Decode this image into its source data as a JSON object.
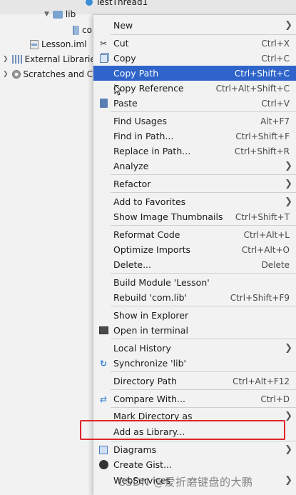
{
  "tree": {
    "top_item": "TestThread1",
    "lib_folder": "lib",
    "lib_child": "co",
    "lesson_iml": "Lesson.iml",
    "external_libraries": "External Librarie",
    "scratches": "Scratches and Co"
  },
  "menu": {
    "items": [
      {
        "label": "New",
        "shortcut": "",
        "submenu": true,
        "icon": ""
      },
      {
        "label": "Cut",
        "shortcut": "Ctrl+X",
        "submenu": false,
        "icon": "scissors-icon"
      },
      {
        "label": "Copy",
        "shortcut": "Ctrl+C",
        "submenu": false,
        "icon": "copy-icon"
      },
      {
        "label": "Copy Path",
        "shortcut": "Ctrl+Shift+C",
        "submenu": false,
        "icon": "",
        "highlighted": true
      },
      {
        "label": "Copy Reference",
        "shortcut": "Ctrl+Alt+Shift+C",
        "submenu": false,
        "icon": ""
      },
      {
        "label": "Paste",
        "shortcut": "Ctrl+V",
        "submenu": false,
        "icon": "paste-icon"
      },
      {
        "label": "Find Usages",
        "shortcut": "Alt+F7",
        "submenu": false,
        "icon": ""
      },
      {
        "label": "Find in Path...",
        "shortcut": "Ctrl+Shift+F",
        "submenu": false,
        "icon": ""
      },
      {
        "label": "Replace in Path...",
        "shortcut": "Ctrl+Shift+R",
        "submenu": false,
        "icon": ""
      },
      {
        "label": "Analyze",
        "shortcut": "",
        "submenu": true,
        "icon": ""
      },
      {
        "label": "Refactor",
        "shortcut": "",
        "submenu": true,
        "icon": ""
      },
      {
        "label": "Add to Favorites",
        "shortcut": "",
        "submenu": true,
        "icon": ""
      },
      {
        "label": "Show Image Thumbnails",
        "shortcut": "Ctrl+Shift+T",
        "submenu": false,
        "icon": ""
      },
      {
        "label": "Reformat Code",
        "shortcut": "Ctrl+Alt+L",
        "submenu": false,
        "icon": ""
      },
      {
        "label": "Optimize Imports",
        "shortcut": "Ctrl+Alt+O",
        "submenu": false,
        "icon": ""
      },
      {
        "label": "Delete...",
        "shortcut": "Delete",
        "submenu": false,
        "icon": ""
      },
      {
        "label": "Build Module 'Lesson'",
        "shortcut": "",
        "submenu": false,
        "icon": ""
      },
      {
        "label": "Rebuild 'com.lib'",
        "shortcut": "Ctrl+Shift+F9",
        "submenu": false,
        "icon": ""
      },
      {
        "label": "Show in Explorer",
        "shortcut": "",
        "submenu": false,
        "icon": ""
      },
      {
        "label": "Open in terminal",
        "shortcut": "",
        "submenu": false,
        "icon": "terminal-icon"
      },
      {
        "label": "Local History",
        "shortcut": "",
        "submenu": true,
        "icon": ""
      },
      {
        "label": "Synchronize 'lib'",
        "shortcut": "",
        "submenu": false,
        "icon": "sync-icon"
      },
      {
        "label": "Directory Path",
        "shortcut": "Ctrl+Alt+F12",
        "submenu": false,
        "icon": ""
      },
      {
        "label": "Compare With...",
        "shortcut": "Ctrl+D",
        "submenu": false,
        "icon": "compare-icon"
      },
      {
        "label": "Mark Directory as",
        "shortcut": "",
        "submenu": true,
        "icon": ""
      },
      {
        "label": "Add as Library...",
        "shortcut": "",
        "submenu": false,
        "icon": ""
      },
      {
        "label": "Diagrams",
        "shortcut": "",
        "submenu": true,
        "icon": "diagram-icon"
      },
      {
        "label": "Create Gist...",
        "shortcut": "",
        "submenu": false,
        "icon": "github-icon"
      },
      {
        "label": "WebServices",
        "shortcut": "",
        "submenu": true,
        "icon": ""
      }
    ]
  },
  "watermark": "CSDN @爱折磨键盘的大鹏",
  "colors": {
    "highlight": "#2f65ca",
    "annotation": "#e0242a",
    "menu_bg": "#f2f2f2"
  }
}
